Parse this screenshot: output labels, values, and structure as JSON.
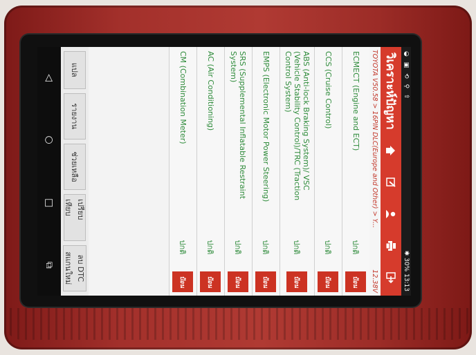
{
  "status": {
    "left_icons": [
      "◒",
      "▣",
      "⟲",
      "⚲",
      "⇧"
    ],
    "battery": "30%",
    "time": "13:13",
    "wifi": "✱"
  },
  "header": {
    "title": "วิเคราะห์ปัญหา"
  },
  "breadcrumb": {
    "path": "TOYOTA V50.58 > 16PIN DLC(Europe and Other) > Y...",
    "voltage": "12.38V"
  },
  "rows": [
    {
      "system": "ECMECT (Engine and ECT)",
      "status": "ปกติ",
      "button": "ป้อน"
    },
    {
      "system": "CCS (Cruise Control)",
      "status": "ปกติ",
      "button": "ป้อน"
    },
    {
      "system": "ABS (Anti-lock Braking System)/ VSC (Vehicle Stability Control)/TRC (Traction Control System)",
      "status": "ปกติ",
      "button": "ป้อน"
    },
    {
      "system": "EMPS (Electronic Motor Power Steering)",
      "status": "ปกติ",
      "button": "ป้อน"
    },
    {
      "system": "SRS (Supplemental Inflatable Restraint System)",
      "status": "ปกติ",
      "button": "ป้อน"
    },
    {
      "system": "AC (Air Conditioning)",
      "status": "ปกติ",
      "button": "ป้อน"
    },
    {
      "system": "CM (Combination Meter)",
      "status": "ปกติ",
      "button": "ป้อน"
    }
  ],
  "bottom": {
    "translate": "แปล",
    "report": "รายงาน",
    "help": "ช่วยเหลือ",
    "compare": "เปรียบเทียบ",
    "clear_dtc": "ลบ DTC",
    "rescan": "สแกนใหม่"
  },
  "colors": {
    "accent": "#d63b2c",
    "status_ok": "#2e8b3a"
  }
}
